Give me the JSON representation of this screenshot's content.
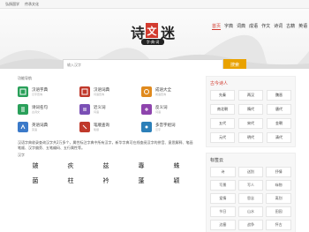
{
  "topbar": {
    "left_link": "弘扬国学",
    "right_link": "传承文化"
  },
  "logo": {
    "text_left": "诗",
    "text_seal": "文",
    "text_right": "迷",
    "subtitle": "字·典·词"
  },
  "nav": [
    "首页",
    "字典",
    "词典",
    "成语",
    "作文",
    "诗词",
    "古籍",
    "英语"
  ],
  "search": {
    "placeholder": "输入汉字",
    "button": "搜索"
  },
  "functions": {
    "title": "功能导航",
    "items": [
      {
        "name": "汉语字典",
        "desc": "汉字查询",
        "color": "#2aa05a"
      },
      {
        "name": "汉语词典",
        "desc": "词语查询",
        "color": "#c0392b"
      },
      {
        "name": "成语大全",
        "desc": "成语查询",
        "color": "#e08a1e"
      },
      {
        "name": "诗词名句",
        "desc": "古诗文",
        "color": "#2aa05a"
      },
      {
        "name": "近义词",
        "desc": "词语",
        "color": "#7a4fb5"
      },
      {
        "name": "反义词",
        "desc": "词语",
        "color": "#8e44ad"
      },
      {
        "name": "英语词典",
        "desc": "英语",
        "color": "#3b7ac9"
      },
      {
        "name": "笔顺查询",
        "desc": "笔顺",
        "color": "#c0392b"
      },
      {
        "name": "多音字组词",
        "desc": "汉字",
        "color": "#2c7fb8"
      }
    ]
  },
  "intro": "汉语字典收录查询汉字共2万多个，属性标注字典中所有汉字，新华字典可在线查阅汉字的拼音、意思解释、笔画笔顺、汉字偏旁、五笔编码、五行属性等。",
  "hanzi_section_title": "汉字",
  "hanzi": [
    "皴",
    "疢",
    "兹",
    "專",
    "蛛",
    "菌",
    "柱",
    "衿",
    "蓬",
    "颖"
  ],
  "dynasty_panel": {
    "title": "古今诗人",
    "items": [
      "先秦",
      "两汉",
      "魏晋",
      "南北朝",
      "隋代",
      "唐代",
      "五代",
      "宋代",
      "金朝",
      "元代",
      "明代",
      "清代"
    ]
  },
  "tag_panel": {
    "title": "标签云",
    "tags": [
      "诗",
      "送别",
      "抒情",
      "写景",
      "写人",
      "咏物",
      "爱情",
      "思念",
      "离别",
      "节日",
      "山水",
      "田园",
      "边塞",
      "战争",
      "怀古"
    ]
  }
}
